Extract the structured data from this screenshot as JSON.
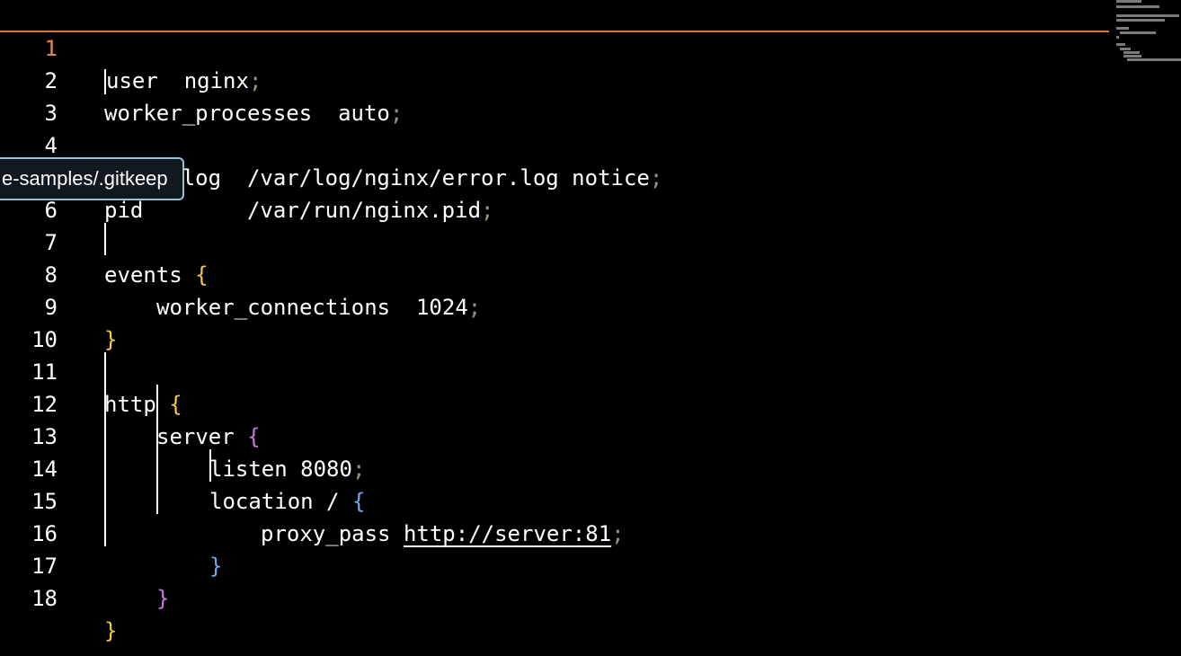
{
  "editor": {
    "current_line": 1,
    "lines": [
      {
        "n": "1",
        "text": "user  nginx"
      },
      {
        "n": "2",
        "text": "worker_processes  auto"
      },
      {
        "n": "3",
        "text": ""
      },
      {
        "n": "4",
        "text": "error_log  /var/log/nginx/error.log notice"
      },
      {
        "n": "5",
        "text": "pid        /var/run/nginx.pid"
      },
      {
        "n": "6",
        "text": ""
      },
      {
        "n": "7",
        "text": "events"
      },
      {
        "n": "8",
        "text": "worker_connections  1024"
      },
      {
        "n": "9",
        "text": "}"
      },
      {
        "n": "10",
        "text": ""
      },
      {
        "n": "11",
        "text": "http"
      },
      {
        "n": "12",
        "text": "server"
      },
      {
        "n": "13",
        "text": "listen 8080"
      },
      {
        "n": "14",
        "text": "location /"
      },
      {
        "n": "15",
        "text": "proxy_pass"
      },
      {
        "n": "16",
        "text": "}"
      },
      {
        "n": "17",
        "text": "}"
      },
      {
        "n": "18",
        "text": "}"
      }
    ],
    "url_token": "http://server:81",
    "semicolon": ";",
    "open_brace": "{"
  },
  "tooltip": {
    "text": "e-samples/.gitkeep"
  },
  "colors": {
    "active_line_number": "#e8894a",
    "current_line_border": "#d9782f",
    "brace_level_1": "#f2c94c",
    "brace_level_2": "#c678dd",
    "brace_level_3": "#7aa7e8",
    "semicolon": "#8a9a7a",
    "tooltip_border": "#8cc4d8"
  }
}
